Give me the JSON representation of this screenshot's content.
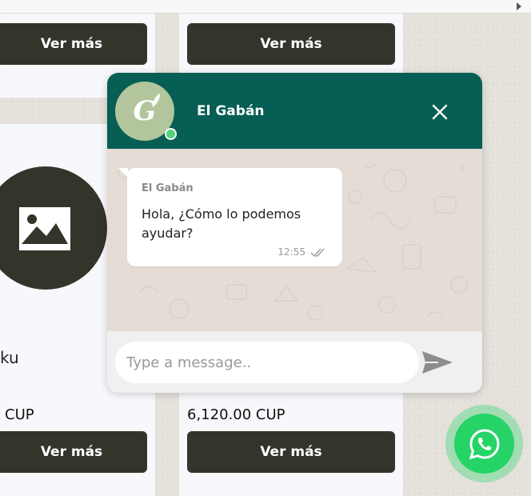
{
  "products": {
    "button_label": "Ver más",
    "partial_title": "ku",
    "partial_price": "CUP",
    "price_d": "6,120.00 CUP"
  },
  "chat": {
    "name": "El Gabán",
    "avatar_letter": "G",
    "message": {
      "sender": "El Gabán",
      "text": "Hola, ¿Cómo lo podemos ayudar?",
      "time": "12:55"
    },
    "input_placeholder": "Type a message..",
    "header_color": "#075e54"
  },
  "icons": {
    "close": "close-icon",
    "send": "send-icon",
    "whatsapp": "whatsapp-icon",
    "image_placeholder": "image-placeholder-icon",
    "read_ticks": "double-check-icon"
  },
  "colors": {
    "button_bg": "#33352a",
    "whatsapp_green": "#25d366",
    "online": "#4fd37a"
  }
}
